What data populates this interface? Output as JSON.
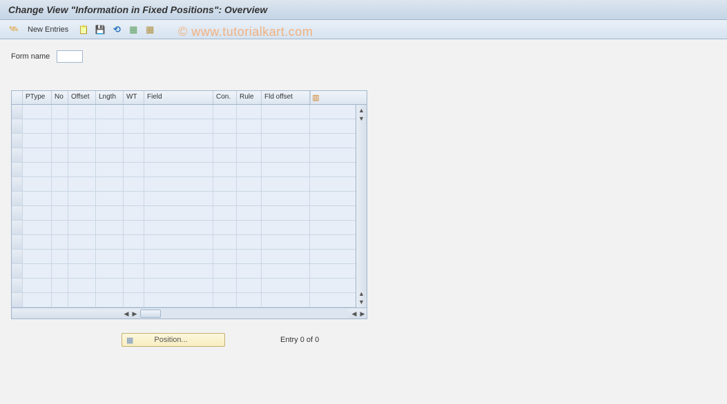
{
  "header": {
    "title": "Change View \"Information in Fixed Positions\": Overview"
  },
  "toolbar": {
    "new_entries": "New Entries"
  },
  "watermark": "© www.tutorialkart.com",
  "form": {
    "name_label": "Form name",
    "name_value": ""
  },
  "grid": {
    "columns": {
      "ptype": "PType",
      "no": "No",
      "offset": "Offset",
      "lngth": "Lngth",
      "wt": "WT",
      "field": "Field",
      "con": "Con.",
      "rule": "Rule",
      "fldoffset": "Fld offset"
    },
    "rows": [
      {},
      {},
      {},
      {},
      {},
      {},
      {},
      {},
      {},
      {},
      {},
      {},
      {},
      {}
    ]
  },
  "footer": {
    "position_label": "Position...",
    "entry_status": "Entry 0 of 0"
  }
}
